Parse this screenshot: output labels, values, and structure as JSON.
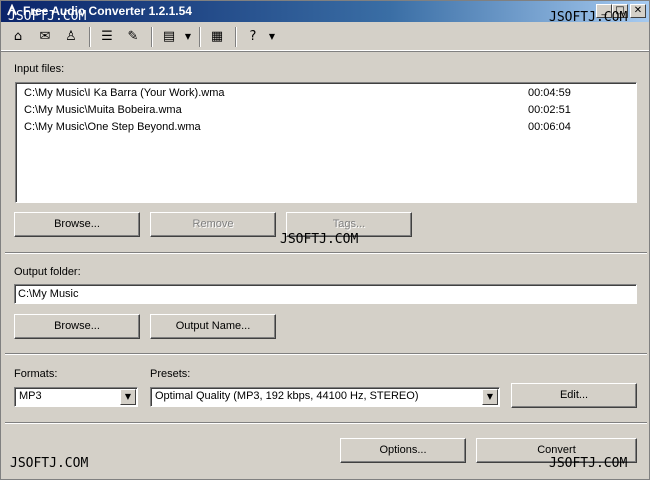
{
  "window": {
    "title": "Free Audio Converter 1.2.1.54"
  },
  "titlebar": {
    "minimize": "_",
    "maximize": "□",
    "close": "✕"
  },
  "toolbar": {
    "icons": {
      "home": "⌂",
      "mail": "✉",
      "user": "♙",
      "list": "☰",
      "edit": "✎",
      "panel": "▤",
      "panel_drop": "▼",
      "film": "▦",
      "help": "?",
      "help_drop": "▼"
    }
  },
  "input": {
    "label": "Input files:",
    "files": [
      {
        "path": "C:\\My Music\\I Ka Barra (Your Work).wma",
        "duration": "00:04:59"
      },
      {
        "path": "C:\\My Music\\Muita Bobeira.wma",
        "duration": "00:02:51"
      },
      {
        "path": "C:\\My Music\\One Step Beyond.wma",
        "duration": "00:06:04"
      }
    ],
    "browse_label": "Browse...",
    "remove_label": "Remove",
    "tags_label": "Tags..."
  },
  "output": {
    "label": "Output folder:",
    "folder": "C:\\My Music",
    "browse_label": "Browse...",
    "output_name_label": "Output Name..."
  },
  "formats": {
    "label": "Formats:",
    "selected": "MP3"
  },
  "presets": {
    "label": "Presets:",
    "selected": "Optimal Quality (MP3, 192 kbps, 44100 Hz, STEREO)",
    "edit_label": "Edit..."
  },
  "footer": {
    "options_label": "Options...",
    "convert_label": "Convert"
  },
  "watermark": {
    "text": "JSOFTJ.COM"
  }
}
